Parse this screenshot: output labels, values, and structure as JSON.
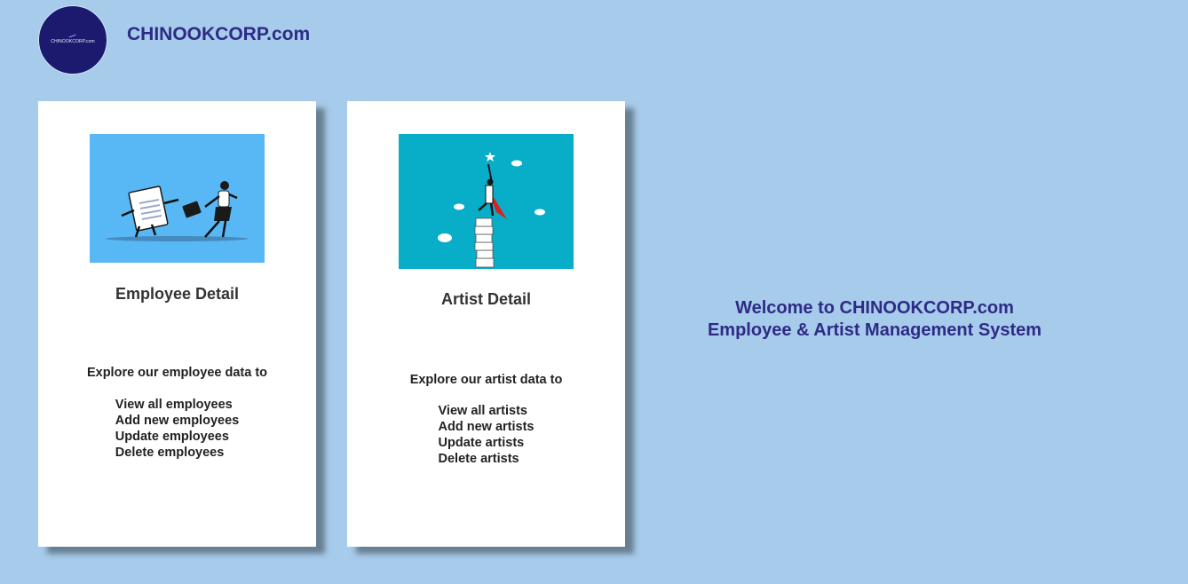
{
  "header": {
    "logo_text": "CHINOOKCORP.com",
    "brand_title": "CHINOOKCORP.com"
  },
  "cards": [
    {
      "title": "Employee Detail",
      "image_icon": "running-tax-document-illustration",
      "intro": "Explore our employee data to",
      "items": [
        "View all employees",
        "Add new employees",
        "Update employees",
        "Delete employees"
      ]
    },
    {
      "title": "Artist Detail",
      "image_icon": "superhero-on-book-stack-illustration",
      "intro": "Explore our artist data to",
      "items": [
        "View all artists",
        "Add new artists",
        "Update artists",
        "Delete artists"
      ]
    }
  ],
  "welcome": {
    "line1": "Welcome to CHINOOKCORP.com",
    "line2": "Employee & Artist Management System"
  },
  "colors": {
    "background": "#a7cbeb",
    "brand": "#2e2b86",
    "logo_bg": "#1c1a6e",
    "employee_image_bg": "#58b8f5",
    "artist_image_bg": "#08adc8"
  }
}
